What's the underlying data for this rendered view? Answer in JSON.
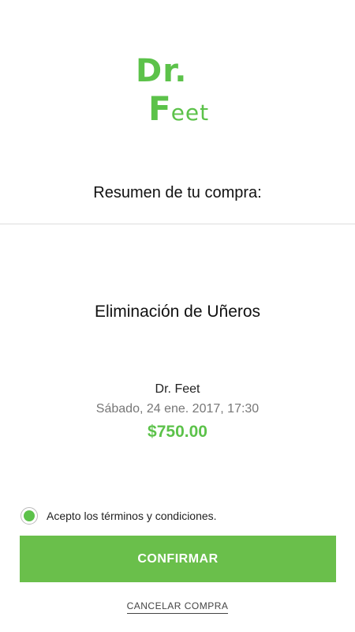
{
  "logo": {
    "line1": "Dr.",
    "line2_initial": "F",
    "line2_rest": "eet"
  },
  "summary": {
    "title": "Resumen de tu compra:"
  },
  "service": {
    "name": "Eliminación de Uñeros"
  },
  "booking": {
    "provider": "Dr. Feet",
    "datetime": "Sábado, 24 ene. 2017, 17:30",
    "price": "$750.00"
  },
  "terms": {
    "label": "Acepto los términos y condiciones.",
    "accepted": true
  },
  "actions": {
    "confirm_label": "CONFIRMAR",
    "cancel_label": "CANCELAR COMPRA"
  },
  "colors": {
    "accent": "#5cc24a",
    "button": "#6abf4b",
    "divider": "#dddddd"
  }
}
